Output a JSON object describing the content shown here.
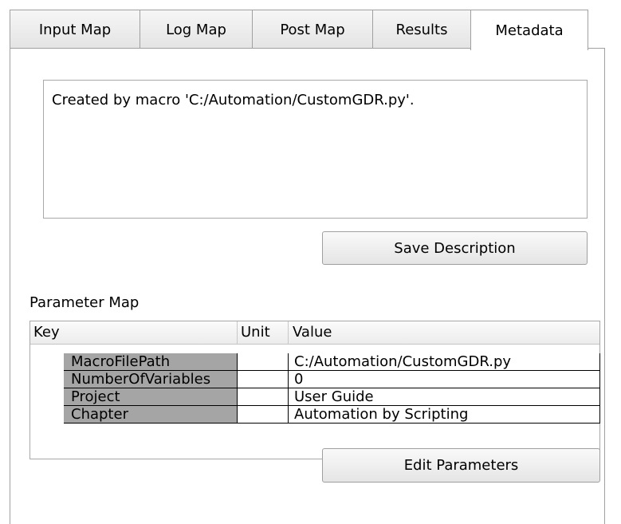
{
  "tabs": [
    {
      "label": "Input Map",
      "active": false
    },
    {
      "label": "Log Map",
      "active": false
    },
    {
      "label": "Post Map",
      "active": false
    },
    {
      "label": "Results",
      "active": false
    },
    {
      "label": "Metadata",
      "active": true
    }
  ],
  "metadata": {
    "description": "Created by macro 'C:/Automation/CustomGDR.py'.",
    "save_button_label": "Save Description",
    "parameter_map_label": "Parameter Map",
    "edit_button_label": "Edit Parameters",
    "table": {
      "headers": {
        "key": "Key",
        "unit": "Unit",
        "value": "Value"
      },
      "rows": [
        {
          "key": "MacroFilePath",
          "unit": "",
          "value": "C:/Automation/CustomGDR.py"
        },
        {
          "key": "NumberOfVariables",
          "unit": "",
          "value": "0"
        },
        {
          "key": "Project",
          "unit": "",
          "value": "User Guide"
        },
        {
          "key": "Chapter",
          "unit": "",
          "value": "Automation by Scripting"
        }
      ]
    }
  },
  "colors": {
    "key_cell_bg": "#a5a5a5",
    "border": "#a0a0a0"
  }
}
